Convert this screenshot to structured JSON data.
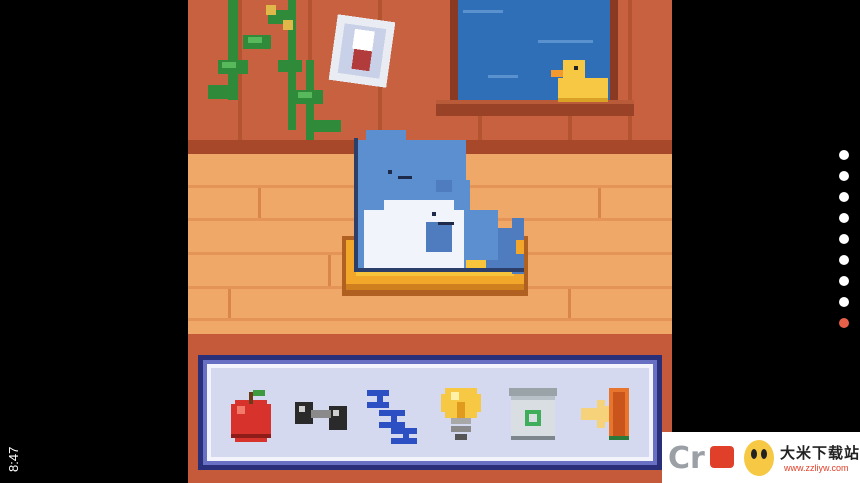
{
  "status_bar": {
    "time": "8:47"
  },
  "toolbar": {
    "buttons": [
      {
        "name": "feed",
        "icon": "apple-icon"
      },
      {
        "name": "exercise",
        "icon": "dumbbell-icon"
      },
      {
        "name": "sleep",
        "icon": "zzz-icon"
      },
      {
        "name": "light",
        "icon": "lightbulb-icon"
      },
      {
        "name": "clean",
        "icon": "recycle-bin-icon"
      },
      {
        "name": "exit",
        "icon": "exit-door-icon"
      }
    ]
  },
  "pager": {
    "total": 9,
    "active_index": 8,
    "active_color": "#e8604a",
    "inactive_color": "#ffffff"
  },
  "watermark": {
    "title": "大米下载站",
    "url": "www.zzliyw.com"
  },
  "colors": {
    "wall": "#c8613f",
    "floor": "#f0a868",
    "window_sky": "#2f6fb8",
    "toolbar_border": "#2a2f7a",
    "toolbar_bg": "#d4d9f0"
  }
}
